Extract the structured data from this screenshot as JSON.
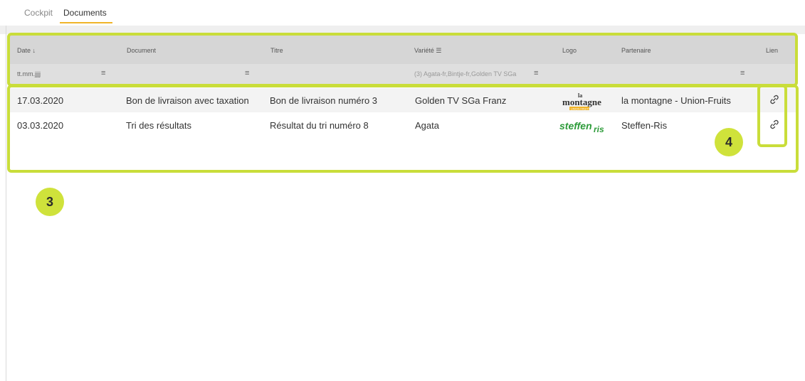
{
  "tabs": {
    "cockpit": "Cockpit",
    "documents": "Documents"
  },
  "columns": {
    "date": "Date ↓",
    "document": "Document",
    "titre": "Titre",
    "variete": "Variété",
    "logo": "Logo",
    "partenaire": "Partenaire",
    "lien": "Lien"
  },
  "filters": {
    "date_placeholder": "tt.mm.jjjj",
    "variete_value": "(3) Agata-fr,Bintje-fr,Golden TV SGa"
  },
  "rows": [
    {
      "date": "17.03.2020",
      "document": "Bon de livraison avec taxation",
      "titre": "Bon de livraison numéro 3",
      "variete": "Golden TV SGa Franz",
      "logo": {
        "top": "la",
        "main": "montagne",
        "sub": "UNION-FRUITS"
      },
      "partenaire": "la montagne - Union-Fruits"
    },
    {
      "date": "03.03.2020",
      "document": "Tri des résultats",
      "titre": "Résultat du tri numéro 8",
      "variete": "Agata",
      "logo": {
        "main": "steffen",
        "sub": "ris"
      },
      "partenaire": "Steffen-Ris"
    }
  ],
  "annotations": {
    "badge3": "3",
    "badge4": "4"
  },
  "colors": {
    "accent": "#f0b429",
    "highlight": "#c9dd3a",
    "badge": "#cfe23b"
  }
}
